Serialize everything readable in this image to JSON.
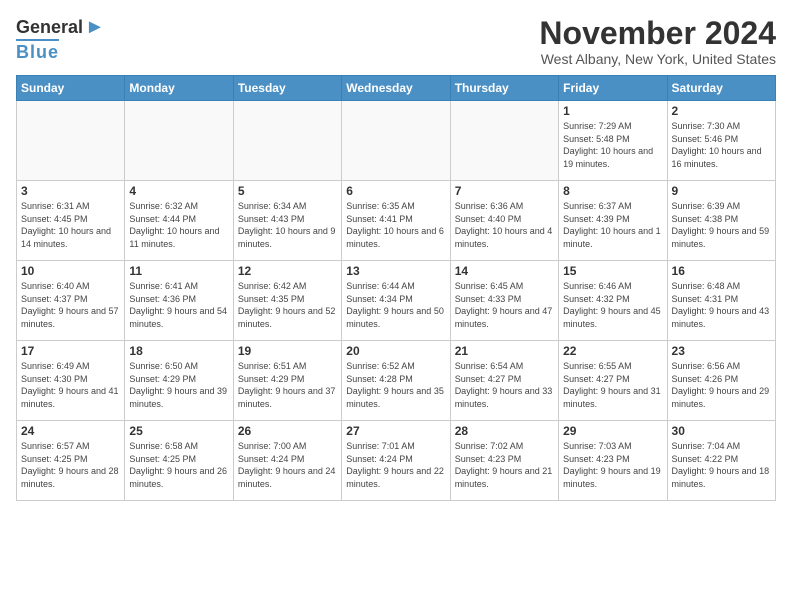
{
  "logo": {
    "line1": "General",
    "line2": "Blue",
    "bird": "▲"
  },
  "title": "November 2024",
  "location": "West Albany, New York, United States",
  "headers": [
    "Sunday",
    "Monday",
    "Tuesday",
    "Wednesday",
    "Thursday",
    "Friday",
    "Saturday"
  ],
  "weeks": [
    [
      {
        "day": "",
        "info": ""
      },
      {
        "day": "",
        "info": ""
      },
      {
        "day": "",
        "info": ""
      },
      {
        "day": "",
        "info": ""
      },
      {
        "day": "",
        "info": ""
      },
      {
        "day": "1",
        "info": "Sunrise: 7:29 AM\nSunset: 5:48 PM\nDaylight: 10 hours and 19 minutes."
      },
      {
        "day": "2",
        "info": "Sunrise: 7:30 AM\nSunset: 5:46 PM\nDaylight: 10 hours and 16 minutes."
      }
    ],
    [
      {
        "day": "3",
        "info": "Sunrise: 6:31 AM\nSunset: 4:45 PM\nDaylight: 10 hours and 14 minutes."
      },
      {
        "day": "4",
        "info": "Sunrise: 6:32 AM\nSunset: 4:44 PM\nDaylight: 10 hours and 11 minutes."
      },
      {
        "day": "5",
        "info": "Sunrise: 6:34 AM\nSunset: 4:43 PM\nDaylight: 10 hours and 9 minutes."
      },
      {
        "day": "6",
        "info": "Sunrise: 6:35 AM\nSunset: 4:41 PM\nDaylight: 10 hours and 6 minutes."
      },
      {
        "day": "7",
        "info": "Sunrise: 6:36 AM\nSunset: 4:40 PM\nDaylight: 10 hours and 4 minutes."
      },
      {
        "day": "8",
        "info": "Sunrise: 6:37 AM\nSunset: 4:39 PM\nDaylight: 10 hours and 1 minute."
      },
      {
        "day": "9",
        "info": "Sunrise: 6:39 AM\nSunset: 4:38 PM\nDaylight: 9 hours and 59 minutes."
      }
    ],
    [
      {
        "day": "10",
        "info": "Sunrise: 6:40 AM\nSunset: 4:37 PM\nDaylight: 9 hours and 57 minutes."
      },
      {
        "day": "11",
        "info": "Sunrise: 6:41 AM\nSunset: 4:36 PM\nDaylight: 9 hours and 54 minutes."
      },
      {
        "day": "12",
        "info": "Sunrise: 6:42 AM\nSunset: 4:35 PM\nDaylight: 9 hours and 52 minutes."
      },
      {
        "day": "13",
        "info": "Sunrise: 6:44 AM\nSunset: 4:34 PM\nDaylight: 9 hours and 50 minutes."
      },
      {
        "day": "14",
        "info": "Sunrise: 6:45 AM\nSunset: 4:33 PM\nDaylight: 9 hours and 47 minutes."
      },
      {
        "day": "15",
        "info": "Sunrise: 6:46 AM\nSunset: 4:32 PM\nDaylight: 9 hours and 45 minutes."
      },
      {
        "day": "16",
        "info": "Sunrise: 6:48 AM\nSunset: 4:31 PM\nDaylight: 9 hours and 43 minutes."
      }
    ],
    [
      {
        "day": "17",
        "info": "Sunrise: 6:49 AM\nSunset: 4:30 PM\nDaylight: 9 hours and 41 minutes."
      },
      {
        "day": "18",
        "info": "Sunrise: 6:50 AM\nSunset: 4:29 PM\nDaylight: 9 hours and 39 minutes."
      },
      {
        "day": "19",
        "info": "Sunrise: 6:51 AM\nSunset: 4:29 PM\nDaylight: 9 hours and 37 minutes."
      },
      {
        "day": "20",
        "info": "Sunrise: 6:52 AM\nSunset: 4:28 PM\nDaylight: 9 hours and 35 minutes."
      },
      {
        "day": "21",
        "info": "Sunrise: 6:54 AM\nSunset: 4:27 PM\nDaylight: 9 hours and 33 minutes."
      },
      {
        "day": "22",
        "info": "Sunrise: 6:55 AM\nSunset: 4:27 PM\nDaylight: 9 hours and 31 minutes."
      },
      {
        "day": "23",
        "info": "Sunrise: 6:56 AM\nSunset: 4:26 PM\nDaylight: 9 hours and 29 minutes."
      }
    ],
    [
      {
        "day": "24",
        "info": "Sunrise: 6:57 AM\nSunset: 4:25 PM\nDaylight: 9 hours and 28 minutes."
      },
      {
        "day": "25",
        "info": "Sunrise: 6:58 AM\nSunset: 4:25 PM\nDaylight: 9 hours and 26 minutes."
      },
      {
        "day": "26",
        "info": "Sunrise: 7:00 AM\nSunset: 4:24 PM\nDaylight: 9 hours and 24 minutes."
      },
      {
        "day": "27",
        "info": "Sunrise: 7:01 AM\nSunset: 4:24 PM\nDaylight: 9 hours and 22 minutes."
      },
      {
        "day": "28",
        "info": "Sunrise: 7:02 AM\nSunset: 4:23 PM\nDaylight: 9 hours and 21 minutes."
      },
      {
        "day": "29",
        "info": "Sunrise: 7:03 AM\nSunset: 4:23 PM\nDaylight: 9 hours and 19 minutes."
      },
      {
        "day": "30",
        "info": "Sunrise: 7:04 AM\nSunset: 4:22 PM\nDaylight: 9 hours and 18 minutes."
      }
    ]
  ]
}
